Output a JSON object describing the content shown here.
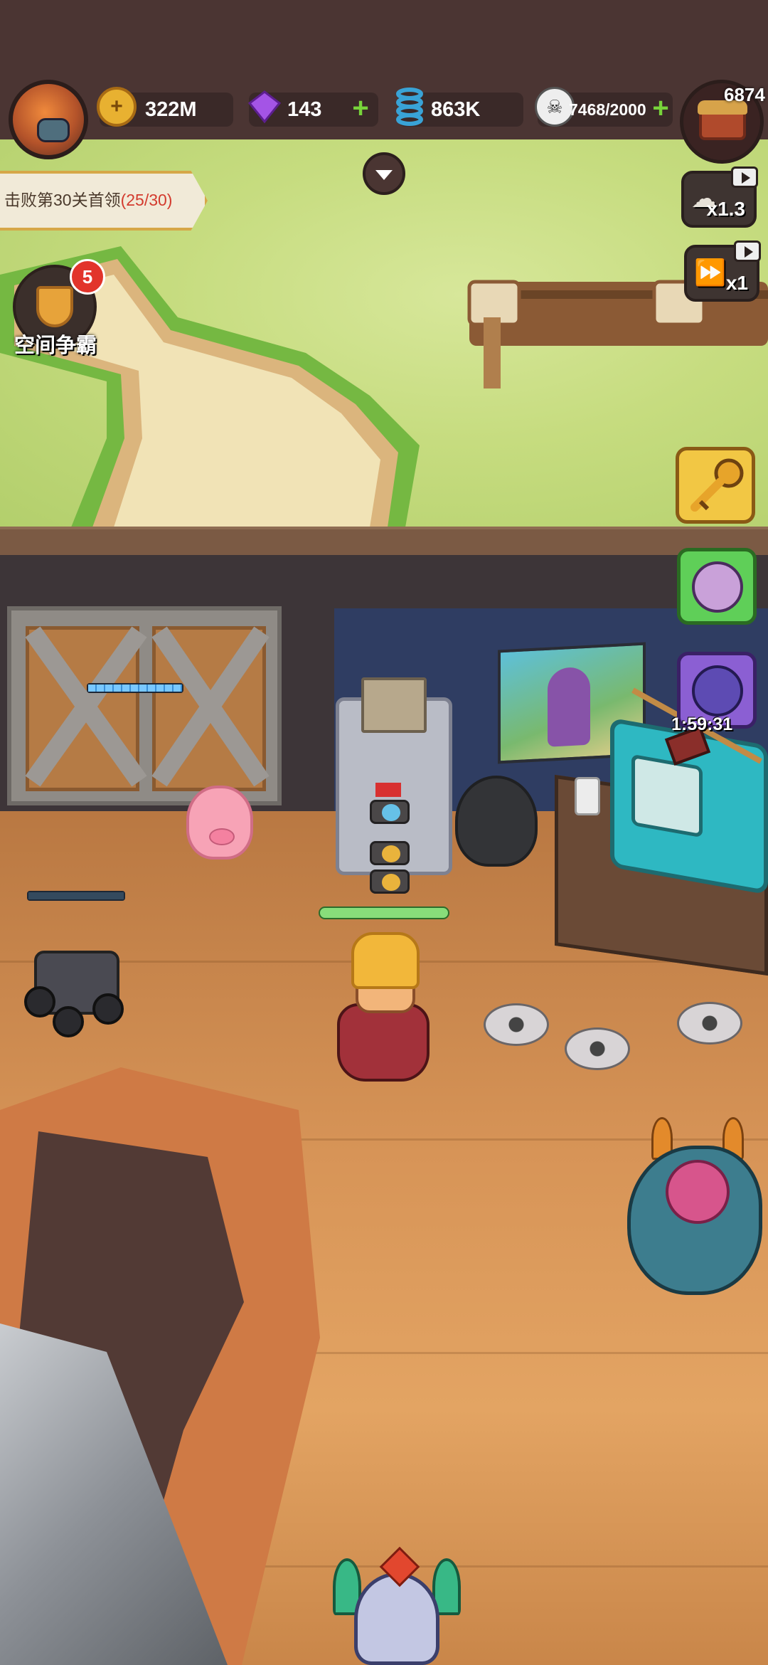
{
  "hud": {
    "gold": "322M",
    "gems": "143",
    "springs": "863K",
    "skulls": "7468/2000",
    "chest_count": "6874",
    "icons": {
      "avatar": "player-avatar-icon",
      "gold": "gold-coin-icon",
      "gems": "purple-gem-icon",
      "springs": "spring-icon",
      "skulls": "skull-icon",
      "chest": "treasure-chest-icon"
    }
  },
  "quest": {
    "text": "击败第30关首领",
    "progress": "(25/30)"
  },
  "arena": {
    "label": "空间争霸",
    "badge": "5"
  },
  "speed": {
    "reward_multiplier": "x1.3",
    "game_speed": "x1"
  },
  "side": {
    "timer": "1:59:31"
  },
  "colors": {
    "hud_bg": "#4b3533",
    "grass": "#c6dc7f",
    "floor": "#d79457",
    "accent_green": "#77d33a",
    "badge_red": "#e2342b",
    "quest_progress_red": "#d33b2e"
  }
}
